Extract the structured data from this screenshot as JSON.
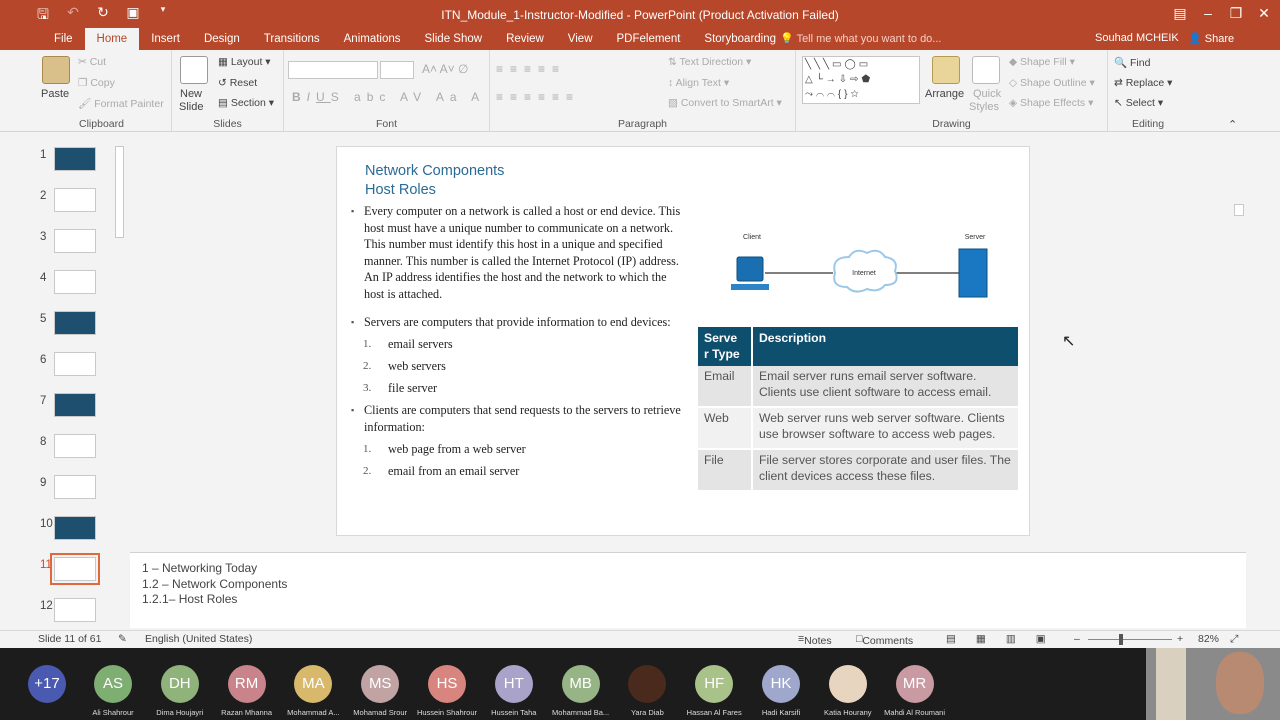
{
  "window": {
    "title": "ITN_Module_1-Instructor-Modified - PowerPoint (Product Activation Failed)"
  },
  "tabs": [
    "File",
    "Home",
    "Insert",
    "Design",
    "Transitions",
    "Animations",
    "Slide Show",
    "Review",
    "View",
    "PDFelement",
    "Storyboarding"
  ],
  "tellme": "Tell me what you want to do...",
  "user": "Souhad MCHEIK",
  "share": "Share",
  "clipboard": {
    "paste": "Paste",
    "cut": "Cut",
    "copy": "Copy",
    "format_painter": "Format Painter",
    "label": "Clipboard"
  },
  "slides_group": {
    "new_slide": "New",
    "new_slide2": "Slide",
    "layout": "Layout",
    "reset": "Reset",
    "section": "Section",
    "label": "Slides"
  },
  "font_group": {
    "label": "Font"
  },
  "paragraph": {
    "text_direction": "Text Direction",
    "align_text": "Align Text",
    "convert": "Convert to SmartArt",
    "label": "Paragraph"
  },
  "drawing": {
    "arrange": "Arrange",
    "quick": "Quick",
    "styles": "Styles",
    "fill": "Shape Fill",
    "outline": "Shape Outline",
    "effects": "Shape Effects",
    "label": "Drawing"
  },
  "editing": {
    "find": "Find",
    "replace": "Replace",
    "select": "Select",
    "label": "Editing"
  },
  "slide": {
    "title1": "Network Components",
    "title2": "Host Roles",
    "b1": "Every computer on a network is called a host or end device. This host must have a unique number to communicate on a network. This number must identify this host in a unique and specified manner. This number is called the Internet Protocol (IP) address. An IP address identifies the host and the network to which the host is attached.",
    "b2": "Servers are computers that provide information to end devices:",
    "servers": [
      "email servers",
      "web servers",
      "file server"
    ],
    "b3": "Clients are computers that send requests to the servers to retrieve information:",
    "clients": [
      "web page from a web server",
      "email from an email server"
    ],
    "diagram": {
      "client": "Client",
      "internet": "Internet",
      "server": "Server"
    },
    "table": {
      "h1": "Serve r Type",
      "h2": "Description",
      "rows": [
        {
          "type": "Email",
          "desc": "Email server runs email server software. Clients use client software to access email."
        },
        {
          "type": "Web",
          "desc": "Web server runs web server software. Clients use browser software to access web pages."
        },
        {
          "type": "File",
          "desc": "File server stores corporate and user files. The client devices access these files."
        }
      ]
    }
  },
  "notes": [
    "1 – Networking Today",
    "1.2 – Network Components",
    "1.2.1– Host Roles"
  ],
  "status": {
    "slide": "Slide 11 of 61",
    "lang": "English (United States)",
    "notes": "Notes",
    "comments": "Comments",
    "zoom": "82%"
  },
  "thumbs": [
    "1",
    "2",
    "3",
    "4",
    "5",
    "6",
    "7",
    "8",
    "9",
    "10",
    "11",
    "12"
  ],
  "meeting": {
    "more": "+17",
    "participants": [
      {
        "init": "AS",
        "name": "Ali Shahrour",
        "color": "#7fae73"
      },
      {
        "init": "DH",
        "name": "Dima Houjayri",
        "color": "#8fb37b"
      },
      {
        "init": "RM",
        "name": "Razan Mhanna",
        "color": "#c8848a"
      },
      {
        "init": "MA",
        "name": "Mohammad A...",
        "color": "#d8b86a"
      },
      {
        "init": "MS",
        "name": "Mohamad Srour",
        "color": "#c1a3a4"
      },
      {
        "init": "HS",
        "name": "Hussein Shahrour",
        "color": "#d8857f"
      },
      {
        "init": "HT",
        "name": "Hussein Taha",
        "color": "#a9a2c9"
      },
      {
        "init": "MB",
        "name": "Mohammad Ba...",
        "color": "#96b485"
      },
      {
        "init": "",
        "name": "Yara Diab",
        "color": "#4a2a1c"
      },
      {
        "init": "HF",
        "name": "Hassan Al Fares",
        "color": "#a8c289"
      },
      {
        "init": "HK",
        "name": "Hadi Karsifi",
        "color": "#9fa8cc"
      },
      {
        "init": "",
        "name": "Katia Hourany",
        "color": "#e8d5c0"
      },
      {
        "init": "MR",
        "name": "Mahdi Al Roumani",
        "color": "#c99aa1"
      }
    ]
  }
}
